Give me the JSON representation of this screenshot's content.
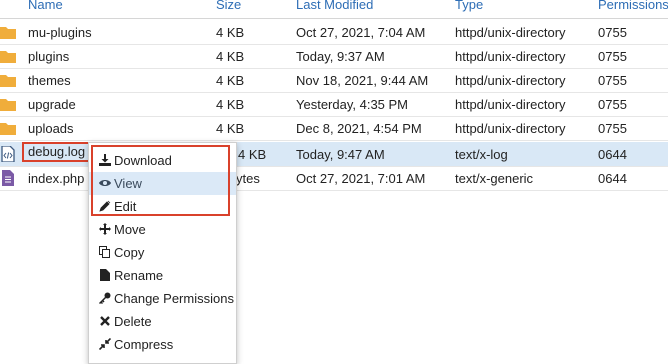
{
  "columns": {
    "name": "Name",
    "size": "Size",
    "modified": "Last Modified",
    "type": "Type",
    "perms": "Permissions"
  },
  "rows": [
    {
      "name": "mu-plugins",
      "size": "4 KB",
      "modified": "Oct 27, 2021, 7:04 AM",
      "type": "httpd/unix-directory",
      "perms": "0755",
      "icon": "folder-icon"
    },
    {
      "name": "plugins",
      "size": "4 KB",
      "modified": "Today, 9:37 AM",
      "type": "httpd/unix-directory",
      "perms": "0755",
      "icon": "folder-icon"
    },
    {
      "name": "themes",
      "size": "4 KB",
      "modified": "Nov 18, 2021, 9:44 AM",
      "type": "httpd/unix-directory",
      "perms": "0755",
      "icon": "folder-icon"
    },
    {
      "name": "upgrade",
      "size": "4 KB",
      "modified": "Yesterday, 4:35 PM",
      "type": "httpd/unix-directory",
      "perms": "0755",
      "icon": "folder-icon"
    },
    {
      "name": "uploads",
      "size": "4 KB",
      "modified": "Dec 8, 2021, 4:54 PM",
      "type": "httpd/unix-directory",
      "perms": "0755",
      "icon": "folder-icon"
    },
    {
      "name": "debug.log",
      "size": "4 KB",
      "modified": "Today, 9:47 AM",
      "type": "text/x-log",
      "perms": "0644",
      "icon": "code-file-icon"
    },
    {
      "name": "index.php",
      "size": "ytes",
      "modified": "Oct 27, 2021, 7:01 AM",
      "type": "text/x-generic",
      "perms": "0644",
      "icon": "file-icon"
    }
  ],
  "context_menu": [
    {
      "label": "Download",
      "icon": "download-icon"
    },
    {
      "label": "View",
      "icon": "eye-icon"
    },
    {
      "label": "Edit",
      "icon": "pencil-icon"
    },
    {
      "label": "Move",
      "icon": "move-icon"
    },
    {
      "label": "Copy",
      "icon": "copy-icon"
    },
    {
      "label": "Rename",
      "icon": "file-icon"
    },
    {
      "label": "Change Permissions",
      "icon": "key-icon"
    },
    {
      "label": "Delete",
      "icon": "x-icon"
    },
    {
      "label": "Compress",
      "icon": "compress-icon"
    }
  ],
  "colors": {
    "link": "#2d6db5",
    "selected_row": "#d9e8f6",
    "highlight_border": "#d9412b",
    "folder": "#f0ad3b"
  }
}
